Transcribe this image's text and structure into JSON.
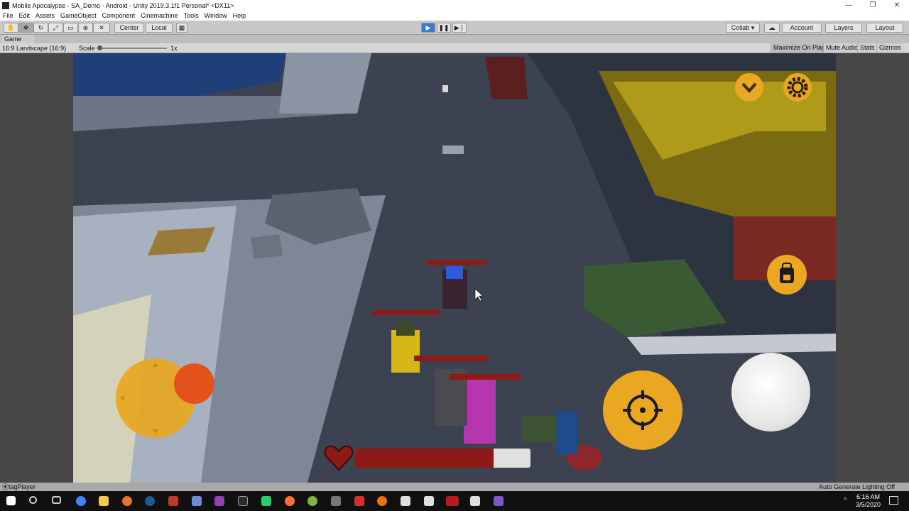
{
  "window": {
    "title": "Mobile Apocalypse - SA_Demo - Android - Unity 2019.3.1f1 Personal* <DX11>",
    "controls": [
      "—",
      "❐",
      "✕"
    ]
  },
  "menu": [
    "File",
    "Edit",
    "Assets",
    "GameObject",
    "Component",
    "Cinemachine",
    "Tools",
    "Window",
    "Help"
  ],
  "toolbar": {
    "pivot": "Center",
    "space": "Local",
    "collab": "Collab ▾",
    "account": "Account",
    "layers": "Layers",
    "layout": "Layout"
  },
  "game_tab": {
    "label": "Game"
  },
  "game_bar": {
    "aspect": "16:9 Landscape (16:9)",
    "scale_label": "Scale",
    "scale_value": "1x",
    "maximize": "Maximize On Play",
    "mute": "Mute Audio",
    "stats": "Stats",
    "gizmos": "Gizmos"
  },
  "hud": {
    "player_health": 0.79,
    "health_color": "#8e1a16"
  },
  "status": {
    "left": "tagPlayer",
    "right": "Auto Generate Lighting Off"
  },
  "clock": {
    "time": "6:16 AM",
    "date": "3/5/2020"
  },
  "taskbar_icons": [
    "windows-start",
    "search",
    "task-view",
    "chrome",
    "file-explorer",
    "app-orange",
    "steam",
    "app-red",
    "discord",
    "app-purple",
    "epic-games",
    "app-green",
    "firefox",
    "app-lime",
    "app-gray",
    "app-red2",
    "blender",
    "unity",
    "app-white",
    "app-video",
    "unity2",
    "visual-studio"
  ]
}
